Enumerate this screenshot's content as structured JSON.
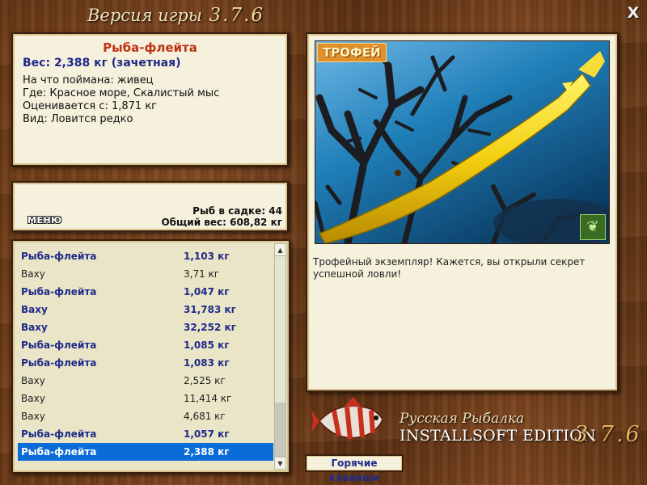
{
  "window": {
    "title": "Версия игры",
    "version": "3.7.6",
    "close_label": "X"
  },
  "info": {
    "fish_name": "Рыба-флейта",
    "weight": "Вес: 2,388 кг (зачетная)",
    "lines": [
      "На что поймана: живец",
      "Где: Красное море, Скалистый мыс",
      "Оценивается с: 1,871 кг",
      "Вид: Ловится редко"
    ]
  },
  "stats": {
    "fish_count": "Рыб в садке: 44",
    "total_weight": "Общий вес: 608,82 кг",
    "menu_label": "МЕНЮ"
  },
  "catch_list": [
    {
      "name": "Рыба-флейта",
      "weight": "1,103 кг",
      "trophy": true,
      "selected": false
    },
    {
      "name": "Ваху",
      "weight": "3,71 кг",
      "trophy": false,
      "selected": false
    },
    {
      "name": "Рыба-флейта",
      "weight": "1,047 кг",
      "trophy": true,
      "selected": false
    },
    {
      "name": "Ваху",
      "weight": "31,783 кг",
      "trophy": true,
      "selected": false
    },
    {
      "name": "Ваху",
      "weight": "32,252 кг",
      "trophy": true,
      "selected": false
    },
    {
      "name": "Рыба-флейта",
      "weight": "1,085 кг",
      "trophy": true,
      "selected": false
    },
    {
      "name": "Рыба-флейта",
      "weight": "1,083 кг",
      "trophy": true,
      "selected": false
    },
    {
      "name": "Ваху",
      "weight": "2,525 кг",
      "trophy": false,
      "selected": false
    },
    {
      "name": "Ваху",
      "weight": "11,414 кг",
      "trophy": false,
      "selected": false
    },
    {
      "name": "Ваху",
      "weight": "4,681 кг",
      "trophy": false,
      "selected": false
    },
    {
      "name": "Рыба-флейта",
      "weight": "1,057 кг",
      "trophy": true,
      "selected": false
    },
    {
      "name": "Рыба-флейта",
      "weight": "2,388 кг",
      "trophy": true,
      "selected": true
    }
  ],
  "photo": {
    "badge": "ТРОФЕЙ",
    "corner_icon": "butterfly-icon"
  },
  "description": "Трофейный экземпляр! Кажется, вы открыли секрет успешной ловли!",
  "branding": {
    "line1": "Русская Рыбалка",
    "line2": "INSTALLSOFT EDITION",
    "version": "3.7.6"
  },
  "hotkeys_label": "Горячие клавиши",
  "colors": {
    "trophy_text": "#1f2a8a",
    "fish_name": "#c03214",
    "selection": "#0a6cd8",
    "panel_bg": "#f6f1dc"
  }
}
